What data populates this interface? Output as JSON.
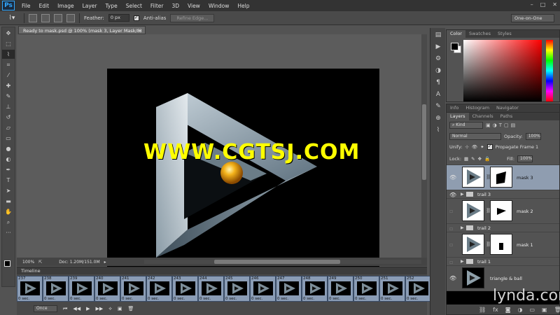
{
  "app": {
    "logo": "Ps"
  },
  "menu": [
    "File",
    "Edit",
    "Image",
    "Layer",
    "Type",
    "Select",
    "Filter",
    "3D",
    "View",
    "Window",
    "Help"
  ],
  "window_controls": [
    "–",
    "□",
    "✕"
  ],
  "options_bar": {
    "feather_label": "Feather:",
    "feather_value": "0 px",
    "antialias_label": "Anti-alias",
    "refine_edge_label": "Refine Edge...",
    "workspace": "One-on-One"
  },
  "document": {
    "tab_title": "Ready to mask.psd @ 100% (mask 3, Layer Mask/8) *",
    "tab_close": "×",
    "zoom": "100%",
    "doc_size": "Doc: 1.20M/151.0M",
    "watermark": "WWW.CGTSJ.COM"
  },
  "timeline": {
    "title": "Timeline",
    "frames": [
      {
        "num": "237",
        "delay": "0 sec."
      },
      {
        "num": "238",
        "delay": "0 sec."
      },
      {
        "num": "239",
        "delay": "0 sec."
      },
      {
        "num": "240",
        "delay": "0 sec."
      },
      {
        "num": "241",
        "delay": "0 sec."
      },
      {
        "num": "242",
        "delay": "0 sec."
      },
      {
        "num": "243",
        "delay": "0 sec."
      },
      {
        "num": "244",
        "delay": "0 sec."
      },
      {
        "num": "245",
        "delay": "0 sec."
      },
      {
        "num": "246",
        "delay": "0 sec."
      },
      {
        "num": "247",
        "delay": "0 sec."
      },
      {
        "num": "248",
        "delay": "0 sec."
      },
      {
        "num": "249",
        "delay": "0 sec."
      },
      {
        "num": "250",
        "delay": "0 sec."
      },
      {
        "num": "251",
        "delay": "0 sec."
      },
      {
        "num": "252",
        "delay": "0 sec."
      }
    ],
    "loop": "Once"
  },
  "color_panel": {
    "tabs": [
      "Color",
      "Swatches",
      "Styles"
    ]
  },
  "info_panel": {
    "tabs": [
      "Info",
      "Histogram",
      "Navigator"
    ]
  },
  "layers_panel": {
    "tabs": [
      "Layers",
      "Channels",
      "Paths"
    ],
    "filter": "Kind",
    "blend_mode": "Normal",
    "opacity_label": "Opacity:",
    "opacity_value": "100%",
    "unify_label": "Unify:",
    "propagate_label": "Propagate Frame 1",
    "lock_label": "Lock:",
    "fill_label": "Fill:",
    "fill_value": "100%",
    "layers": [
      {
        "name": "mask 3",
        "type": "layer",
        "selected": true
      },
      {
        "name": "trail 3",
        "type": "group"
      },
      {
        "name": "mask 2",
        "type": "layer"
      },
      {
        "name": "trail 2",
        "type": "group"
      },
      {
        "name": "mask 1",
        "type": "layer"
      },
      {
        "name": "trail 1",
        "type": "group"
      },
      {
        "name": "triangle & ball",
        "type": "layer"
      }
    ]
  },
  "branding": "lynda.com",
  "colors": {
    "ui_bg": "#535353",
    "selected_layer": "#8f9db0",
    "frame_bg": "#8a9cb5",
    "watermark": "#ffff00"
  }
}
